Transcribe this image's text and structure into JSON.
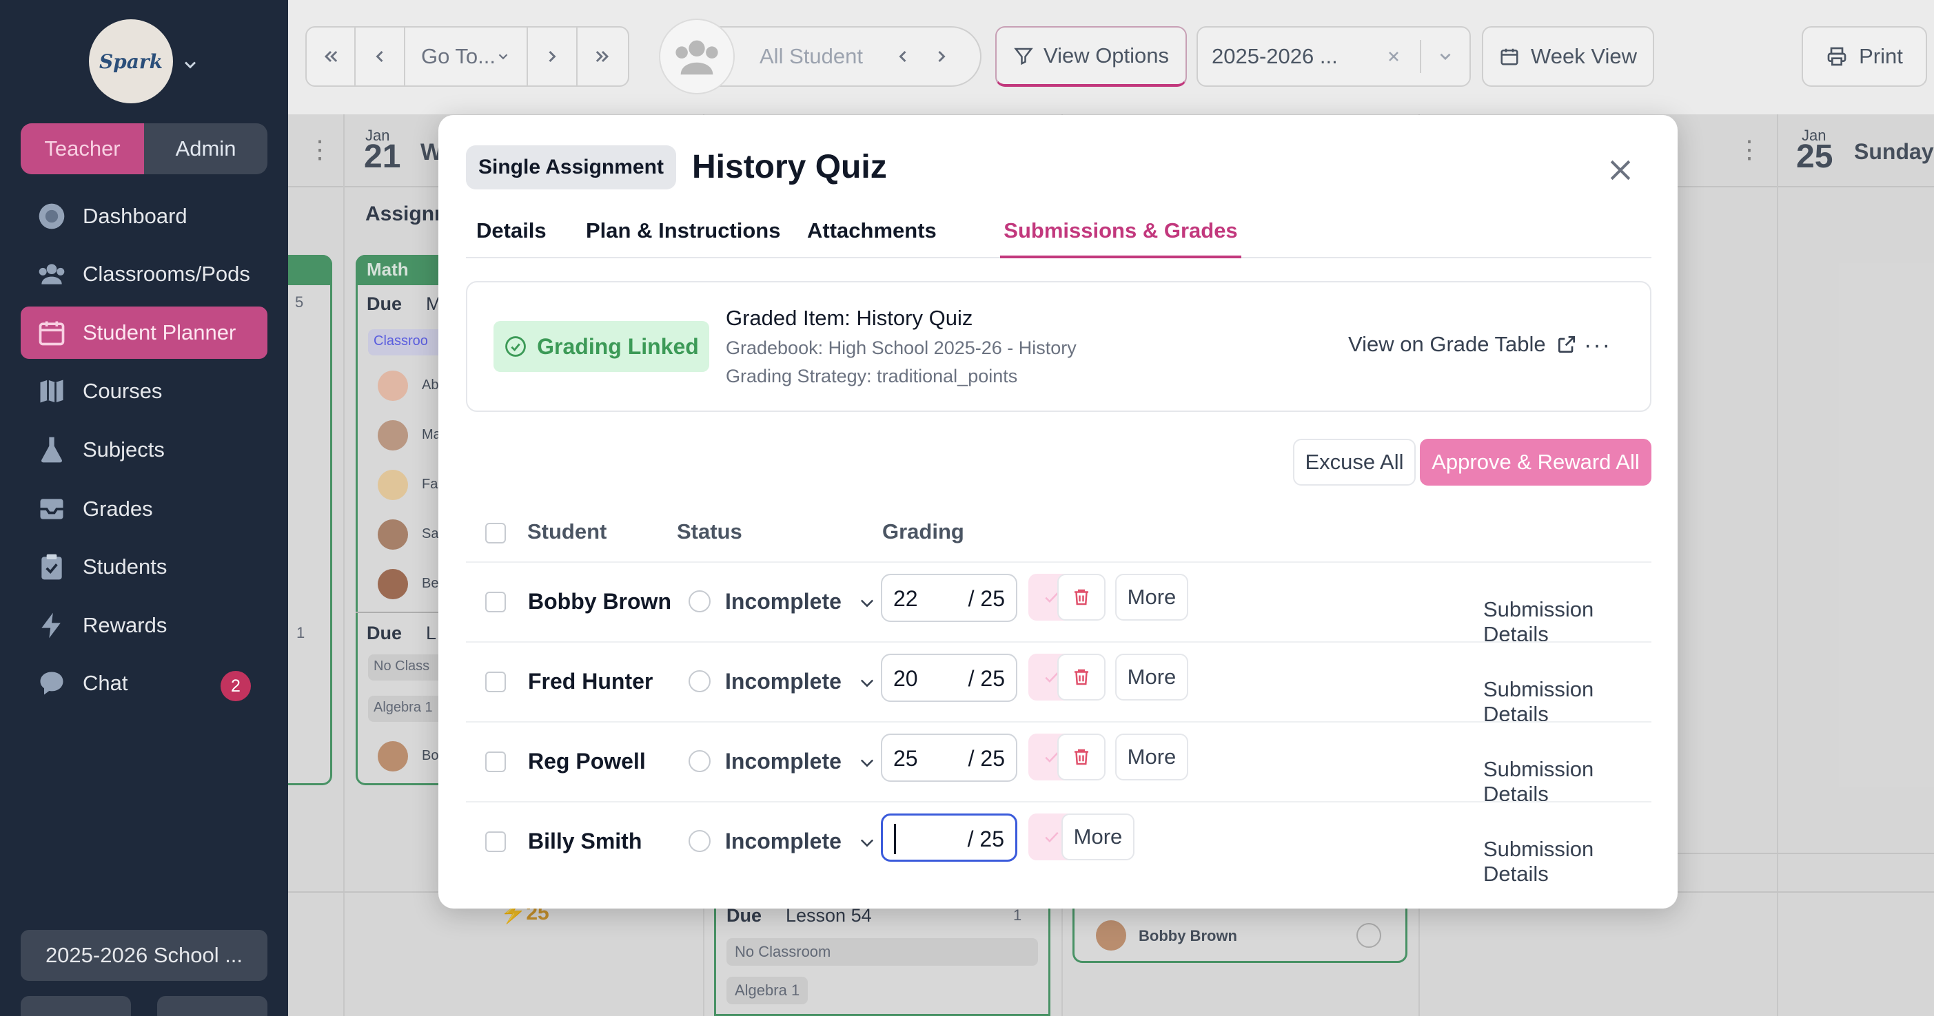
{
  "sidebar": {
    "logo_text": "Spark",
    "roles": [
      "Teacher",
      "Admin"
    ],
    "items": [
      {
        "label": "Dashboard",
        "icon": "dashboard-icon"
      },
      {
        "label": "Classrooms/Pods",
        "icon": "users-icon"
      },
      {
        "label": "Student Planner",
        "icon": "calendar-icon",
        "active": true
      },
      {
        "label": "Courses",
        "icon": "map-icon"
      },
      {
        "label": "Subjects",
        "icon": "flask-icon"
      },
      {
        "label": "Grades",
        "icon": "inbox-icon"
      },
      {
        "label": "Students",
        "icon": "clipboard-icon"
      },
      {
        "label": "Rewards",
        "icon": "bolt-icon"
      },
      {
        "label": "Chat",
        "icon": "chat-icon",
        "badge": "2"
      }
    ],
    "school_year": "2025-2026 School ..."
  },
  "toolbar": {
    "goto": "Go To...",
    "students_filter": "All Student",
    "view_options": "View Options",
    "year": "2025-2026 ...",
    "week_view": "Week View",
    "print": "Print"
  },
  "background": {
    "day1_month": "Jan",
    "day1_num": "21",
    "day1_name": "W",
    "day2_month": "Jan",
    "day2_num": "25",
    "day2_name": "Sunday",
    "assign_header": "Assignm",
    "math_label": "Math",
    "due_label": "Due",
    "due_extra": "M",
    "due2_label": "Due",
    "due2_extra": "L",
    "classroom": "Classroo",
    "no_class": "No Class",
    "algebra": "Algebra 1",
    "lesson_due": "Due",
    "lesson_name": "Lesson 54",
    "no_classroom": "No Classroom",
    "algebra_bottom": "Algebra 1",
    "reward_points": "⚡25",
    "count5": "5",
    "count1": "1",
    "count1b": "1",
    "bobby": "Bobby Brown",
    "student_initials": [
      "Ab",
      "Ma",
      "Fa",
      "Sa",
      "Be"
    ],
    "bo": "Bo"
  },
  "modal": {
    "type_chip": "Single Assignment",
    "title": "History Quiz",
    "tabs": [
      "Details",
      "Plan & Instructions",
      "Attachments",
      "Submissions & Grades"
    ],
    "active_tab": "Submissions & Grades",
    "linked_label": "Grading Linked",
    "graded_item": "Graded Item: History Quiz",
    "gradebook": "Gradebook: High School 2025-26 - History",
    "strategy": "Grading Strategy: traditional_points",
    "view_grade_table": "View on Grade Table",
    "excuse_all": "Excuse All",
    "approve_all": "Approve & Reward All",
    "columns": {
      "student": "Student",
      "status": "Status",
      "grading": "Grading"
    },
    "rows": [
      {
        "name": "Bobby Brown",
        "status": "Incomplete",
        "grade": "22",
        "max": "/ 25",
        "more": "More",
        "details": "Submission Details"
      },
      {
        "name": "Fred Hunter",
        "status": "Incomplete",
        "grade": "20",
        "max": "/ 25",
        "more": "More",
        "details": "Submission Details"
      },
      {
        "name": "Reg Powell",
        "status": "Incomplete",
        "grade": "25",
        "max": "/ 25",
        "more": "More",
        "details": "Submission Details"
      },
      {
        "name": "Billy Smith",
        "status": "Incomplete",
        "grade": "",
        "max": "/ 25",
        "more": "More",
        "details": "Submission Details"
      }
    ]
  },
  "colors": {
    "accent": "#c2387d",
    "sidebar": "#1e293b",
    "success": "#3c9a57"
  }
}
